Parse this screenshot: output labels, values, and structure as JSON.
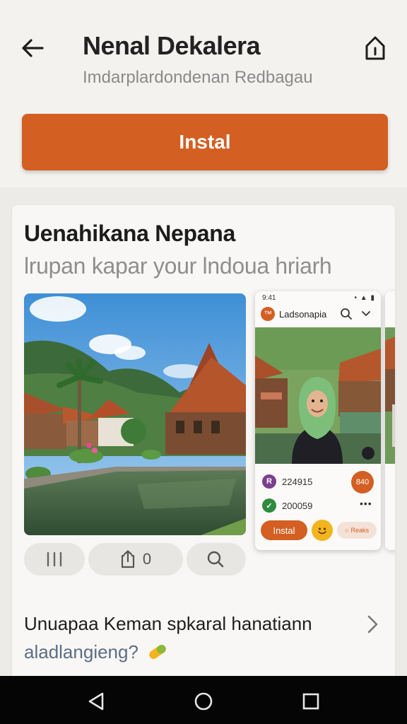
{
  "header": {
    "title": "Nenal Dekalera",
    "subtitle": "Imdarplardondenan Redbagau",
    "install_label": "Instal"
  },
  "card": {
    "title": "Uenahikana Nepana",
    "subtitle": "lrupan kapar your lndoua hriarh",
    "actions": {
      "share_count": "0"
    },
    "preview": {
      "status_time": "9:41",
      "status_icons": "• ▲ ▮",
      "app_name": "Ladsonapia",
      "stat1": "224915",
      "stat2": "200059",
      "count_badge": "840",
      "install_label": "Instal",
      "reactions_label": "Reaks"
    }
  },
  "question": {
    "line1": "Unuapaa Keman spkaral hanatiann",
    "line2": "aladlangieng?"
  },
  "colors": {
    "accent": "#d35f22",
    "background": "#ecebe8",
    "card": "#f8f7f5",
    "navbar": "#050505"
  },
  "icons": [
    "arrow-left-icon",
    "house-icon",
    "menu-bars-icon",
    "share-icon",
    "search-icon",
    "chevron-right-icon",
    "back-triangle-icon",
    "home-circle-icon",
    "recents-square-icon"
  ]
}
